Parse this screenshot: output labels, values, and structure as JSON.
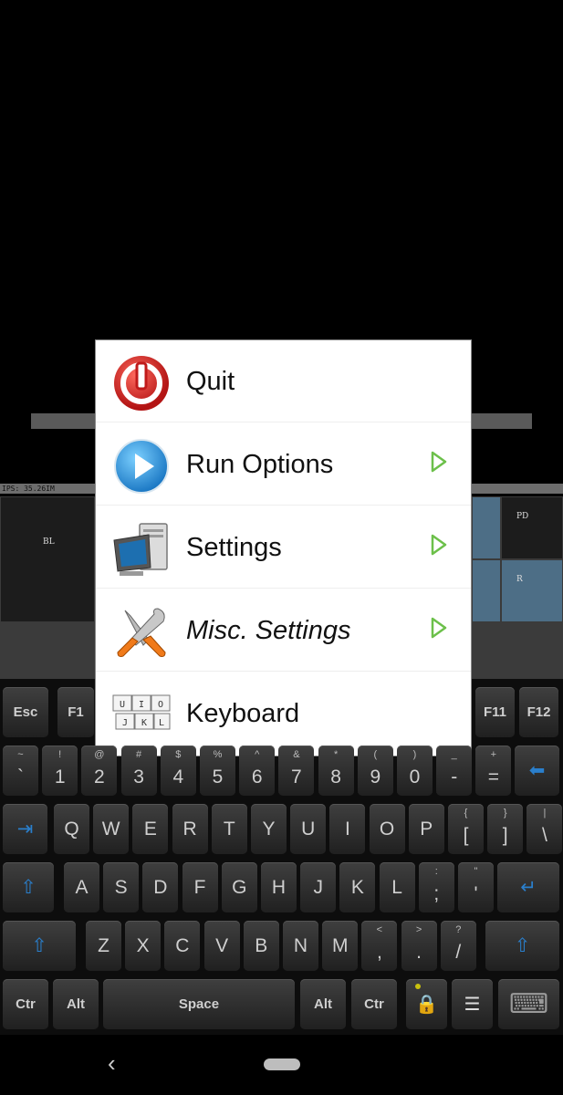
{
  "status": {
    "ips": "IPS: 35.26IM"
  },
  "touch_zones": {
    "bl": "BL",
    "pd": "PD",
    "r": "R"
  },
  "menu": {
    "items": [
      {
        "label": "Quit",
        "icon": "power-icon"
      },
      {
        "label": "Run Options",
        "icon": "play-icon",
        "submenu": true
      },
      {
        "label": "Settings",
        "icon": "computer-icon",
        "submenu": true
      },
      {
        "label": "Misc. Settings",
        "icon": "tools-icon",
        "submenu": true
      },
      {
        "label": "Keyboard",
        "icon": "keyboard-keys-icon",
        "key_caps": [
          "U",
          "I",
          "O",
          "J",
          "K",
          "L"
        ]
      }
    ]
  },
  "keyboard": {
    "row1": [
      "Esc",
      "F1",
      "F11",
      "F12"
    ],
    "row2": [
      [
        "`",
        "~"
      ],
      [
        "1",
        "!"
      ],
      [
        "2",
        "@"
      ],
      [
        "3",
        "#"
      ],
      [
        "4",
        "$"
      ],
      [
        "5",
        "%"
      ],
      [
        "6",
        "^"
      ],
      [
        "7",
        "&"
      ],
      [
        "8",
        "*"
      ],
      [
        "9",
        "("
      ],
      [
        "0",
        ")"
      ],
      [
        "-",
        "_"
      ],
      [
        "=",
        "+"
      ]
    ],
    "row3": [
      "Q",
      "W",
      "E",
      "R",
      "T",
      "Y",
      "U",
      "I",
      "O",
      "P",
      [
        "[",
        "{"
      ],
      [
        "]",
        "}"
      ],
      [
        "\\",
        "|"
      ]
    ],
    "row4": [
      "A",
      "S",
      "D",
      "F",
      "G",
      "H",
      "J",
      "K",
      "L",
      [
        ";",
        ":"
      ],
      [
        "'",
        "\""
      ]
    ],
    "row5": [
      "Z",
      "X",
      "C",
      "V",
      "B",
      "N",
      "M",
      [
        ",",
        "<"
      ],
      [
        ".",
        ">"
      ],
      [
        "/",
        "?"
      ]
    ],
    "row6": {
      "ctrl_left": "Ctr",
      "alt_left": "Alt",
      "space": "Space",
      "alt_right": "Alt",
      "ctrl_right": "Ctr"
    }
  },
  "colors": {
    "accent_blue": "#2a7fcc",
    "menu_arrow_green": "#6cc04a",
    "quit_red": "#d42a2a"
  }
}
